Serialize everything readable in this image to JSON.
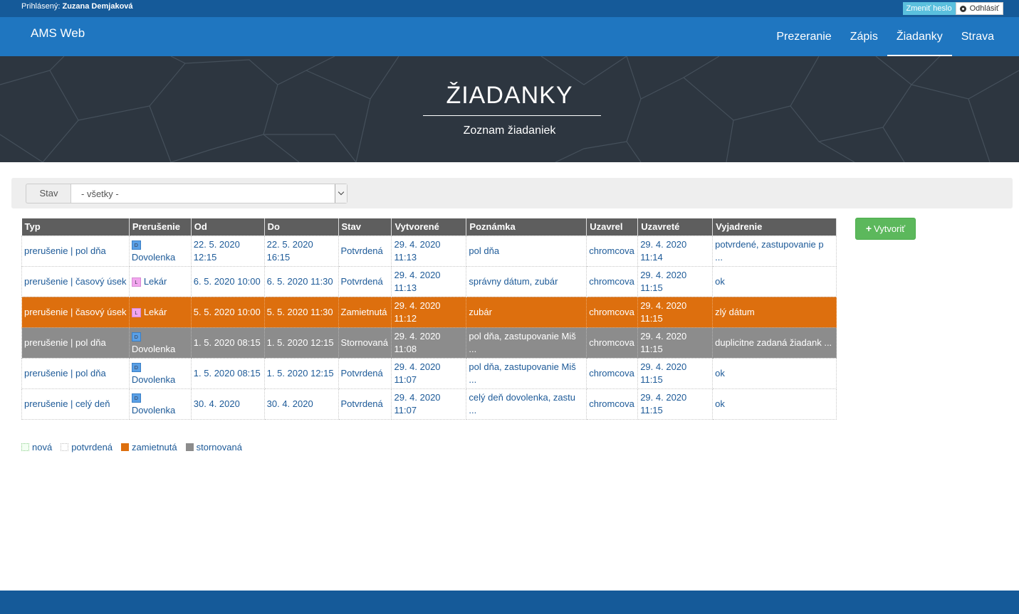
{
  "topbar": {
    "user_prefix": "Prihlásený: ",
    "user_name": "Zuzana Demjaková",
    "change_password": "Zmeniť heslo",
    "logout": "Odhlásiť",
    "logout_icon": "gear-icon"
  },
  "navbar": {
    "brand": "AMS Web",
    "items": [
      {
        "label": "Prezeranie"
      },
      {
        "label": "Zápis"
      },
      {
        "label": "Žiadanky",
        "active": true
      },
      {
        "label": "Strava"
      }
    ]
  },
  "hero": {
    "title": "ŽIADANKY",
    "subtitle": "Zoznam žiadaniek"
  },
  "filter": {
    "label": "Stav",
    "selected": "- všetky -"
  },
  "create_button": {
    "icon": "plus-icon",
    "label": "Vytvoriť"
  },
  "table": {
    "headers": [
      "Typ",
      "Prerušenie",
      "Od",
      "Do",
      "Stav",
      "Vytvorené",
      "Poznámka",
      "Uzavrel",
      "Uzavreté",
      "Vyjadrenie"
    ],
    "rows": [
      {
        "typ": "prerušenie | pol dňa",
        "tag": "D",
        "prerusenie": "Dovolenka",
        "od": "22. 5. 2020 12:15",
        "do": "22. 5. 2020 16:15",
        "stav": "Potvrdená",
        "vytvorene": "29. 4. 2020 11:13",
        "poznamka": "pol dňa",
        "uzavrel": "chromcova",
        "uzavrete": "29. 4. 2020 11:14",
        "vyjadrenie": "potvrdené, zastupovanie p ..."
      },
      {
        "typ": "prerušenie | časový úsek",
        "tag": "L",
        "prerusenie": "Lekár",
        "od": "6. 5. 2020 10:00",
        "do": "6. 5. 2020 11:30",
        "stav": "Potvrdená",
        "vytvorene": "29. 4. 2020 11:13",
        "poznamka": "správny dátum, zubár",
        "uzavrel": "chromcova",
        "uzavrete": "29. 4. 2020 11:15",
        "vyjadrenie": "ok"
      },
      {
        "typ": "prerušenie | časový úsek",
        "tag": "L",
        "prerusenie": "Lekár",
        "od": "5. 5. 2020 10:00",
        "do": "5. 5. 2020 11:30",
        "stav": "Zamietnutá",
        "vytvorene": "29. 4. 2020 11:12",
        "poznamka": "zubár",
        "uzavrel": "chromcova",
        "uzavrete": "29. 4. 2020 11:15",
        "vyjadrenie": "zlý dátum"
      },
      {
        "typ": "prerušenie | pol dňa",
        "tag": "D",
        "prerusenie": "Dovolenka",
        "od": "1. 5. 2020 08:15",
        "do": "1. 5. 2020 12:15",
        "stav": "Stornovaná",
        "vytvorene": "29. 4. 2020 11:08",
        "poznamka": "pol dňa, zastupovanie Miš ...",
        "uzavrel": "chromcova",
        "uzavrete": "29. 4. 2020 11:15",
        "vyjadrenie": "duplicitne zadaná žiadank ..."
      },
      {
        "typ": "prerušenie | pol dňa",
        "tag": "D",
        "prerusenie": "Dovolenka",
        "od": "1. 5. 2020 08:15",
        "do": "1. 5. 2020 12:15",
        "stav": "Potvrdená",
        "vytvorene": "29. 4. 2020 11:07",
        "poznamka": "pol dňa, zastupovanie Miš ...",
        "uzavrel": "chromcova",
        "uzavrete": "29. 4. 2020 11:15",
        "vyjadrenie": "ok"
      },
      {
        "typ": "prerušenie | celý deň",
        "tag": "D",
        "prerusenie": "Dovolenka",
        "od": "30. 4. 2020",
        "do": "30. 4. 2020",
        "stav": "Potvrdená",
        "vytvorene": "29. 4. 2020 11:07",
        "poznamka": "celý deň dovolenka, zastu ...",
        "uzavrel": "chromcova",
        "uzavrete": "29. 4. 2020 11:15",
        "vyjadrenie": "ok"
      }
    ]
  },
  "legend": [
    {
      "label": "nová",
      "color": "#f3fff3"
    },
    {
      "label": "potvrdená",
      "color": "#ffffff"
    },
    {
      "label": "zamietnutá",
      "color": "#dd6f0e"
    },
    {
      "label": "stornovaná",
      "color": "#8c8c8c"
    }
  ],
  "colors": {
    "topbar": "#155a99",
    "navbar": "#1f76c0",
    "rejected_row": "#dd6f0e",
    "cancelled_row": "#8c8c8c",
    "create_button": "#5cb85c"
  }
}
